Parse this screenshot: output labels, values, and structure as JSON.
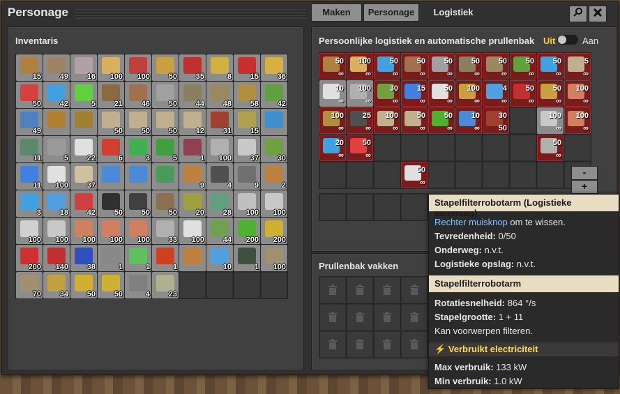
{
  "window": {
    "title": "Personage"
  },
  "tabs": [
    {
      "label": "Maken",
      "active": false
    },
    {
      "label": "Personage",
      "active": false
    },
    {
      "label": "Logistiek",
      "active": true
    }
  ],
  "buttons": {
    "search_icon": "search-icon",
    "close_icon": "close-icon"
  },
  "inventory": {
    "title": "Inventaris",
    "items": [
      {
        "icon": "wooden-chest",
        "color": "#b08040",
        "count": "15"
      },
      {
        "icon": "iron-chest",
        "color": "#9c8366",
        "count": "49"
      },
      {
        "icon": "steel-chest",
        "color": "#b0a0a8",
        "count": "16"
      },
      {
        "icon": "transport-belt",
        "color": "#d8b060",
        "count": "100"
      },
      {
        "icon": "fast-transport-belt",
        "color": "#c04040",
        "count": "100"
      },
      {
        "icon": "underground-belt",
        "color": "#c8a040",
        "count": "50"
      },
      {
        "icon": "fast-underground-belt",
        "color": "#c03030",
        "count": "35"
      },
      {
        "icon": "splitter",
        "color": "#d0b040",
        "count": "8"
      },
      {
        "icon": "fast-splitter",
        "color": "#c83030",
        "count": "15"
      },
      {
        "icon": "burner-inserter",
        "color": "#d8b040",
        "count": "36"
      },
      {
        "icon": "inserter",
        "color": "#d84040",
        "count": "50"
      },
      {
        "icon": "long-inserter",
        "color": "#40a0e0",
        "count": "42"
      },
      {
        "icon": "fast-inserter",
        "color": "#60d040",
        "count": "5"
      },
      {
        "icon": "small-electric-pole",
        "color": "#8a6a40",
        "count": "21"
      },
      {
        "icon": "medium-electric-pole",
        "color": "#a07050",
        "count": "46"
      },
      {
        "icon": "big-electric-pole",
        "color": "#a0a0a0",
        "count": "50"
      },
      {
        "icon": "pipe",
        "color": "#8a8060",
        "count": "44"
      },
      {
        "icon": "pipe-to-ground",
        "color": "#9a8860",
        "count": "48"
      },
      {
        "icon": "rail",
        "color": "#b09040",
        "count": "58"
      },
      {
        "icon": "rail-signal",
        "color": "#60a040",
        "count": "42"
      },
      {
        "icon": "repair-pack",
        "color": "#5080c0",
        "count": "49"
      },
      {
        "icon": "boiler",
        "color": "#b08030",
        "count": ""
      },
      {
        "icon": "steam-engine",
        "color": "#a08030",
        "count": ""
      },
      {
        "icon": "offshore-pump",
        "color": "#c0b090",
        "count": "50"
      },
      {
        "icon": "pump",
        "color": "#c0b090",
        "count": "50"
      },
      {
        "icon": "burner-mining-drill",
        "color": "#c0b090",
        "count": "50"
      },
      {
        "icon": "electric-mining-drill",
        "color": "#c0b090",
        "count": "12"
      },
      {
        "icon": "stone-furnace",
        "color": "#a04030",
        "count": "31"
      },
      {
        "icon": "steel-furnace",
        "color": "#b0a050",
        "count": "15"
      },
      {
        "icon": "assembling-machine",
        "color": "#4090d0",
        "count": ""
      },
      {
        "icon": "assembling-machine-2",
        "color": "#5a8a6a",
        "count": "11"
      },
      {
        "icon": "assembling-machine-3",
        "color": "#9a9a9a",
        "count": "5"
      },
      {
        "icon": "lab",
        "color": "#e0e0e0",
        "count": "22"
      },
      {
        "icon": "red-wire",
        "color": "#d04030",
        "count": "6"
      },
      {
        "icon": "green-wire",
        "color": "#40b050",
        "count": "3"
      },
      {
        "icon": "arithmetic-combinator",
        "color": "#40a040",
        "count": "5"
      },
      {
        "icon": "decider-combinator",
        "color": "#904050",
        "count": "1"
      },
      {
        "icon": "stone-brick",
        "color": "#b0b0b0",
        "count": "100"
      },
      {
        "icon": "concrete",
        "color": "#c8c8c8",
        "count": "37"
      },
      {
        "icon": "landfill",
        "color": "#70a040",
        "count": "30"
      },
      {
        "icon": "battery",
        "color": "#4080e0",
        "count": "11"
      },
      {
        "icon": "repair-tool",
        "color": "#e0e0e0",
        "count": "100"
      },
      {
        "icon": "long-handed-tool",
        "color": "#d0c0a0",
        "count": "37"
      },
      {
        "icon": "solar-panel",
        "color": "#4a8ad8",
        "count": ""
      },
      {
        "icon": "accumulator",
        "color": "#4a8ad8",
        "count": ""
      },
      {
        "icon": "roboport",
        "color": "#4a9a5a",
        "count": ""
      },
      {
        "icon": "construction-robot",
        "color": "#c08040",
        "count": "9"
      },
      {
        "icon": "logistic-robot",
        "color": "#505050",
        "count": "4"
      },
      {
        "icon": "gear",
        "color": "#707070",
        "count": "9"
      },
      {
        "icon": "radar",
        "color": "#c08040",
        "count": "2"
      },
      {
        "icon": "car",
        "color": "#40a0e0",
        "count": "3"
      },
      {
        "icon": "tank",
        "color": "#50a0e0",
        "count": "18"
      },
      {
        "icon": "locomotive",
        "color": "#d04040",
        "count": "42"
      },
      {
        "icon": "coal",
        "color": "#303030",
        "count": "50"
      },
      {
        "icon": "stone",
        "color": "#404040",
        "count": "50"
      },
      {
        "icon": "iron-ore",
        "color": "#8a7050",
        "count": "50"
      },
      {
        "icon": "copper-ore",
        "color": "#a0a040",
        "count": "20"
      },
      {
        "icon": "uranium-ore",
        "color": "#60a080",
        "count": "28"
      },
      {
        "icon": "iron-plate",
        "color": "#c0c0c0",
        "count": "100"
      },
      {
        "icon": "copper-plate",
        "color": "#c8c8c8",
        "count": "100"
      },
      {
        "icon": "steel-plate",
        "color": "#d0d0d0",
        "count": "100"
      },
      {
        "icon": "iron-plate-2",
        "color": "#c8c8c8",
        "count": "100"
      },
      {
        "icon": "copper-plate-2",
        "color": "#d08060",
        "count": "100"
      },
      {
        "icon": "copper-plate-3",
        "color": "#d08060",
        "count": "100"
      },
      {
        "icon": "copper-plate-4",
        "color": "#d08060",
        "count": "100"
      },
      {
        "icon": "steel-beam",
        "color": "#b0b0b0",
        "count": "33"
      },
      {
        "icon": "plastic-bar",
        "color": "#e0e0e0",
        "count": "100"
      },
      {
        "icon": "engine",
        "color": "#70a050",
        "count": "44"
      },
      {
        "icon": "electronic-circuit",
        "color": "#50b030",
        "count": "200"
      },
      {
        "icon": "advanced-circuit",
        "color": "#d0b030",
        "count": "200"
      },
      {
        "icon": "processing-unit",
        "color": "#d03030",
        "count": "200"
      },
      {
        "icon": "circuit-red",
        "color": "#c03030",
        "count": "140"
      },
      {
        "icon": "circuit-blue",
        "color": "#3050c0",
        "count": "38"
      },
      {
        "icon": "pistol",
        "color": "#888888",
        "count": "1"
      },
      {
        "icon": "rocket",
        "color": "#60c060",
        "count": "1"
      },
      {
        "icon": "land-mine",
        "color": "#d04020",
        "count": "1"
      },
      {
        "icon": "armor",
        "color": "#c08040",
        "count": ""
      },
      {
        "icon": "solar-cell",
        "color": "#50a0e0",
        "count": "10"
      },
      {
        "icon": "binoculars",
        "color": "#405040",
        "count": "1"
      },
      {
        "icon": "wall",
        "color": "#a09070",
        "count": "100"
      },
      {
        "icon": "gate",
        "color": "#a09070",
        "count": "70"
      },
      {
        "icon": "hazard-concrete",
        "color": "#c0a040",
        "count": "34"
      },
      {
        "icon": "turret",
        "color": "#d0b030",
        "count": "50"
      },
      {
        "icon": "gun-turret",
        "color": "#d0b030",
        "count": "50"
      },
      {
        "icon": "flamethrower",
        "color": "#808080",
        "count": "4"
      },
      {
        "icon": "artillery",
        "color": "#b0b090",
        "count": "23"
      }
    ],
    "total_slots": 90
  },
  "logistics": {
    "title": "Persoonlijke logistiek en automatische prullenbak",
    "toggle_off": "Uit",
    "toggle_on": "Aan",
    "slots": [
      {
        "icon": "wooden-chest",
        "color": "#b08040",
        "num": "50",
        "max": "∞",
        "style": "red"
      },
      {
        "icon": "transport-belt",
        "color": "#d8b060",
        "num": "100",
        "max": "∞",
        "style": "red"
      },
      {
        "icon": "inserter",
        "color": "#40a0e0",
        "num": "50",
        "max": "∞",
        "style": "red"
      },
      {
        "icon": "small-pole",
        "color": "#a07050",
        "num": "50",
        "max": "∞",
        "style": "red"
      },
      {
        "icon": "big-pole",
        "color": "#a0a0a0",
        "num": "50",
        "max": "∞",
        "style": "red"
      },
      {
        "icon": "pipe",
        "color": "#8a8060",
        "num": "50",
        "max": "∞",
        "style": "red"
      },
      {
        "icon": "pipe-ground",
        "color": "#9a8860",
        "num": "50",
        "max": "∞",
        "style": "red"
      },
      {
        "icon": "signal",
        "color": "#60a040",
        "num": "50",
        "max": "∞",
        "style": "red"
      },
      {
        "icon": "repair",
        "color": "#40a0e0",
        "num": "50",
        "max": "∞",
        "style": "red"
      },
      {
        "icon": "drill",
        "color": "#c0b090",
        "num": "5",
        "max": "∞",
        "style": "red"
      },
      {
        "icon": "lab",
        "color": "#e0e0e0",
        "num": "10",
        "max": "∞",
        "style": "plain"
      },
      {
        "icon": "brick",
        "color": "#b0b0b0",
        "num": "100",
        "max": "∞",
        "style": "plain"
      },
      {
        "icon": "landfill",
        "color": "#70a040",
        "num": "30",
        "max": "∞",
        "style": "red"
      },
      {
        "icon": "battery",
        "color": "#4080e0",
        "num": "15",
        "max": "∞",
        "style": "red"
      },
      {
        "icon": "tool",
        "color": "#e0e0e0",
        "num": "50",
        "max": "∞",
        "style": "red"
      },
      {
        "icon": "ug-belt",
        "color": "#c8a040",
        "num": "100",
        "max": "∞",
        "style": "red"
      },
      {
        "icon": "tank",
        "color": "#50a0e0",
        "num": "4",
        "max": "∞",
        "style": "red"
      },
      {
        "icon": "fast-ug",
        "color": "#c03030",
        "num": "50",
        "max": "∞",
        "style": "red"
      },
      {
        "icon": "ug-belt-2",
        "color": "#c8a040",
        "num": "50",
        "max": "∞",
        "style": "red"
      },
      {
        "icon": "copper",
        "color": "#d08060",
        "num": "100",
        "max": "∞",
        "style": "red"
      },
      {
        "icon": "rail",
        "color": "#b09040",
        "num": "100",
        "max": "∞",
        "style": "red"
      },
      {
        "icon": "logistic-robot",
        "color": "#505050",
        "num": "25",
        "max": "∞",
        "style": "red"
      },
      {
        "icon": "drill-2",
        "color": "#c0b090",
        "num": "100",
        "max": "∞",
        "style": "red"
      },
      {
        "icon": "pump",
        "color": "#c0b090",
        "num": "50",
        "max": "∞",
        "style": "red"
      },
      {
        "icon": "circuit",
        "color": "#50b030",
        "num": "50",
        "max": "∞",
        "style": "red"
      },
      {
        "icon": "solar",
        "color": "#4a8ad8",
        "num": "10",
        "max": "∞",
        "style": "red"
      },
      {
        "icon": "furnace",
        "color": "#a04030",
        "num": "30",
        "max": "50",
        "style": "red"
      },
      {
        "icon": "",
        "color": "",
        "num": "",
        "max": "",
        "style": "empty"
      },
      {
        "icon": "plate",
        "color": "#c8c8c8",
        "num": "100",
        "max": "∞",
        "style": "plain"
      },
      {
        "icon": "copper-plate",
        "color": "#d08060",
        "num": "100",
        "max": "∞",
        "style": "red"
      },
      {
        "icon": "car",
        "color": "#40a0e0",
        "num": "20",
        "max": "∞",
        "style": "red"
      },
      {
        "icon": "filter-inserter",
        "color": "#e04040",
        "num": "50",
        "max": "∞",
        "style": "red"
      },
      {
        "icon": "",
        "color": "",
        "num": "",
        "max": "",
        "style": "empty"
      },
      {
        "icon": "",
        "color": "",
        "num": "",
        "max": "",
        "style": "empty"
      },
      {
        "icon": "",
        "color": "",
        "num": "",
        "max": "",
        "style": "empty"
      },
      {
        "icon": "",
        "color": "",
        "num": "",
        "max": "",
        "style": "empty"
      },
      {
        "icon": "",
        "color": "",
        "num": "",
        "max": "",
        "style": "empty"
      },
      {
        "icon": "",
        "color": "",
        "num": "",
        "max": "",
        "style": "empty"
      },
      {
        "icon": "beam",
        "color": "#b0b0b0",
        "num": "50",
        "max": "∞",
        "style": "red"
      },
      {
        "icon": "",
        "color": "",
        "num": "",
        "max": "",
        "style": "empty"
      },
      {
        "icon": "",
        "color": "",
        "num": "",
        "max": "",
        "style": "empty"
      },
      {
        "icon": "",
        "color": "",
        "num": "",
        "max": "",
        "style": "empty"
      },
      {
        "icon": "",
        "color": "",
        "num": "",
        "max": "",
        "style": "empty"
      },
      {
        "icon": "stack-filter-inserter",
        "color": "#e0e0e0",
        "num": "50",
        "max": "∞",
        "style": "red"
      },
      {
        "icon": "",
        "color": "",
        "num": "",
        "max": "",
        "style": "empty"
      },
      {
        "icon": "",
        "color": "",
        "num": "",
        "max": "",
        "style": "empty"
      },
      {
        "icon": "",
        "color": "",
        "num": "",
        "max": "",
        "style": "empty"
      },
      {
        "icon": "",
        "color": "",
        "num": "",
        "max": "",
        "style": "empty"
      },
      {
        "icon": "",
        "color": "",
        "num": "",
        "max": "",
        "style": "empty"
      },
      {
        "icon": "",
        "color": "",
        "num": "",
        "max": "",
        "style": "empty"
      }
    ],
    "minus": "-",
    "plus": "+"
  },
  "trash": {
    "title": "Prullenbak vakken"
  },
  "tooltip": {
    "title": "Stapelfilterrobotarm (Logistieke aanvraag)",
    "line1_link": "Rechter muisknop",
    "line1_rest": " om te wissen.",
    "satisfaction_label": "Tevredenheid:",
    "satisfaction_value": " 0/50",
    "onroute_label": "Onderweg:",
    "onroute_value": " n.v.t.",
    "storage_label": "Logistieke opslag:",
    "storage_value": " n.v.t.",
    "item_title": "Stapelfilterrobotarm",
    "rot_label": "Rotatiesnelheid:",
    "rot_value": " 864 °/s",
    "stack_label": "Stapelgrootte:",
    "stack_value": " 1 + 11",
    "filter_text": "Kan voorwerpen filteren.",
    "power_title": "Verbruikt electriciteit",
    "max_label": "Max verbruik:",
    "max_value": " 133 kW",
    "min_label": "Min verbruik:",
    "min_value": " 1.0 kW"
  }
}
